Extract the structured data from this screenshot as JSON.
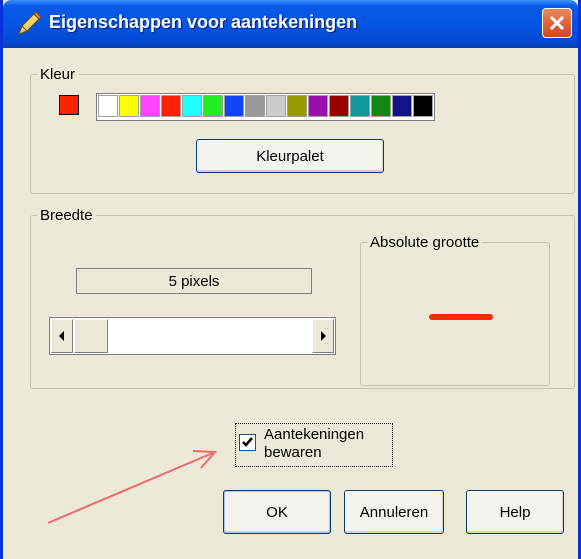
{
  "window": {
    "title": "Eigenschappen voor aantekeningen"
  },
  "kleur": {
    "legend": "Kleur",
    "selected": "#ff2200",
    "swatches": [
      "#ffffff",
      "#ffff00",
      "#ff44ff",
      "#ff2200",
      "#22ffff",
      "#22ee22",
      "#1144ff",
      "#999999",
      "#cccccc",
      "#999900",
      "#9911aa",
      "#990000",
      "#119999",
      "#118811",
      "#111188",
      "#000000"
    ],
    "palette_button": "Kleurpalet"
  },
  "breedte": {
    "legend": "Breedte",
    "pixels_text": "5 pixels",
    "absolute_legend": "Absolute grootte",
    "preview_color": "#ff2a00"
  },
  "save_checkbox": {
    "label_line1": "Aantekeningen",
    "label_line2": "bewaren",
    "checked": true
  },
  "buttons": {
    "ok": "OK",
    "cancel": "Annuleren",
    "help": "Help"
  },
  "annotation_arrow_color": "#ef6a6a"
}
